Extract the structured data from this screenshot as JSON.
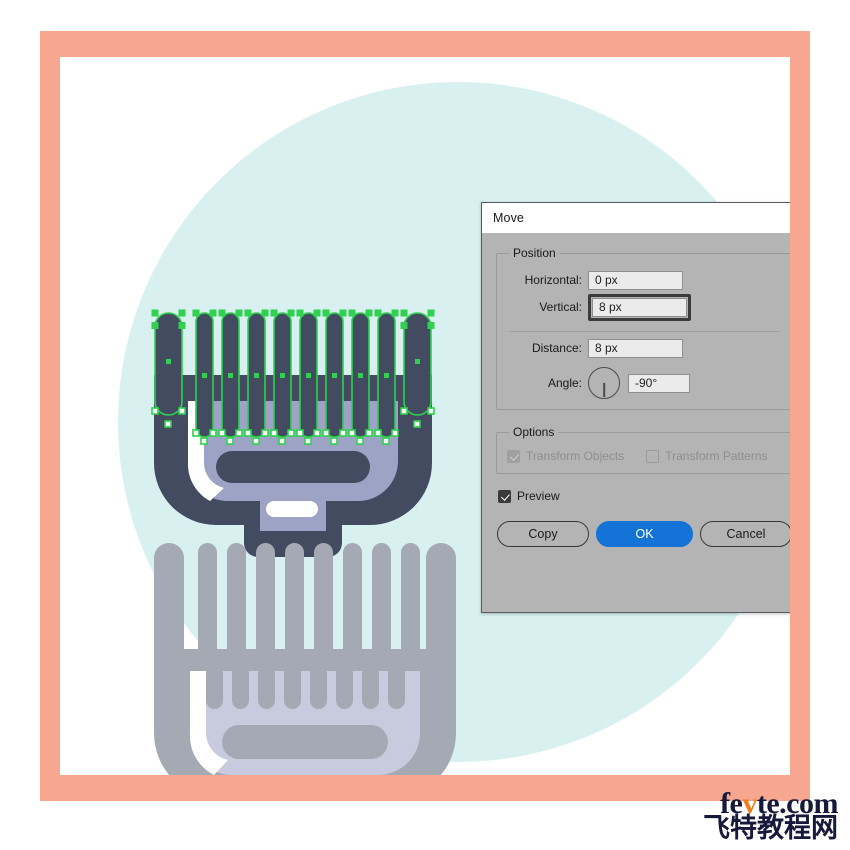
{
  "app": {
    "document_background": "#ffffff",
    "artboard_frame_color": "#f7a790",
    "canvas_color": "#ffffff",
    "decor_circle_color": "#d8f0f0"
  },
  "artwork": {
    "selected_comb": {
      "name": "clipper-guard-comb-selected",
      "body_color": "#434b60",
      "inner_color": "#9da3c4",
      "highlight_color": "#ffffff",
      "tooth_count": 10,
      "selection_path_color": "#2fd14f",
      "anchor_fill": "#2fd14f",
      "anchor_stroke": "#2fd14f"
    },
    "gray_comb": {
      "name": "clipper-guard-comb-ghost",
      "body_color": "#a5a9b4",
      "inner_color": "#c7cbdd",
      "highlight_color": "#ffffff",
      "tooth_count": 10
    }
  },
  "dialog": {
    "title": "Move",
    "position_group": {
      "legend": "Position",
      "horizontal": {
        "label": "Horizontal:",
        "value": "0 px",
        "focused": false
      },
      "vertical": {
        "label": "Vertical:",
        "value": "8 px",
        "focused": true
      },
      "distance": {
        "label": "Distance:",
        "value": "8 px"
      },
      "angle": {
        "label": "Angle:",
        "value": "-90°",
        "dial_icon": "angle-dial-icon"
      }
    },
    "options_group": {
      "legend": "Options",
      "transform_objects": {
        "label": "Transform Objects",
        "checked": true,
        "disabled": true
      },
      "transform_patterns": {
        "label": "Transform Patterns",
        "checked": false,
        "disabled": true
      }
    },
    "preview": {
      "label": "Preview",
      "checked": true,
      "disabled": false
    },
    "buttons": {
      "copy": "Copy",
      "ok": "OK",
      "cancel": "Cancel",
      "primary_color": "#1473d6",
      "primary_text_color": "#ffffff"
    }
  },
  "watermark": {
    "latin_part1": "fe",
    "latin_accent": "v",
    "latin_part2": "te.com",
    "chinese": "飞特教程网",
    "accent_color": "#f07c1a",
    "text_color": "#16183c"
  }
}
